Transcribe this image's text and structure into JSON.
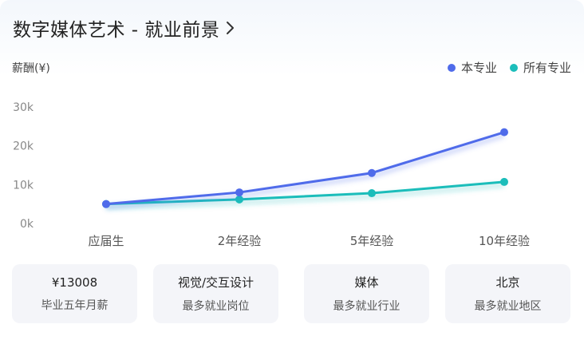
{
  "header": {
    "title": "数字媒体艺术 - 就业前景",
    "chevron_icon": "chevron-right-icon"
  },
  "chart_data": {
    "type": "line",
    "ylabel": "薪酬(¥)",
    "categories": [
      "应届生",
      "2年经验",
      "5年经验",
      "10年经验"
    ],
    "y_ticks": [
      "0k",
      "10k",
      "20k",
      "30k"
    ],
    "ylim": [
      0,
      30000
    ],
    "grid": false,
    "legend_position": "top-right",
    "series": [
      {
        "name": "本专业",
        "color": "#4f6bea",
        "values": [
          5000,
          8000,
          13000,
          23500
        ]
      },
      {
        "name": "所有专业",
        "color": "#1bbdba",
        "values": [
          5000,
          6200,
          7800,
          10700
        ]
      }
    ]
  },
  "stats": [
    {
      "value": "¥13008",
      "label": "毕业五年月薪"
    },
    {
      "value": "视觉/交互设计",
      "label": "最多就业岗位"
    },
    {
      "value": "媒体",
      "label": "最多就业行业"
    },
    {
      "value": "北京",
      "label": "最多就业地区"
    }
  ]
}
